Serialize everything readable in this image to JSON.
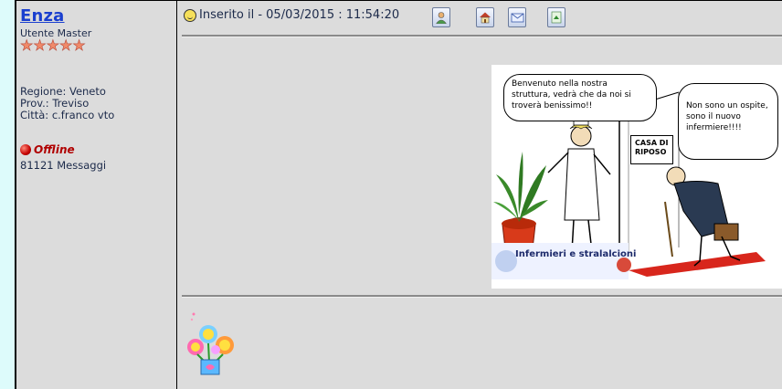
{
  "author": {
    "name": "Enza",
    "rank": "Utente Master",
    "stars": [
      "★",
      "★",
      "★",
      "★",
      "★"
    ],
    "region": "Regione: Veneto",
    "province": "Prov.: Treviso",
    "city": "Città: c.franco vto",
    "status": "Offline",
    "messages": "81121 Messaggi"
  },
  "post": {
    "posted_label": "Inserito il - 05/03/2015 : 11:54:20",
    "tools": [
      "profile-icon",
      "homepage-icon",
      "email-icon",
      "quote-icon"
    ]
  },
  "cartoon": {
    "bubble_left": "Benvenuto nella nostra struttura, vedrà che da noi si troverà benissimo!!",
    "bubble_right": "Non sono un ospite, sono il nuovo infermiere!!!!",
    "sign": "CASA DI RIPOSO",
    "banner": "Infermieri e stralalcioni"
  }
}
